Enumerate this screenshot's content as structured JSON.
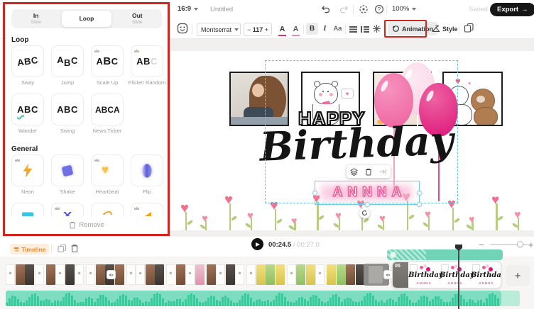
{
  "topbar": {
    "aspect_ratio": "16:9",
    "project_title": "Untitled",
    "zoom_level": "100%",
    "saved_label": "Saved",
    "export_label": "Export",
    "export_arrow": "→"
  },
  "text_toolbar": {
    "font_name": "Montserrat",
    "size_minus": "−",
    "font_size": "117",
    "size_plus": "+",
    "color_letter": "A",
    "highlight_letter": "A",
    "bold": "B",
    "italic": "I",
    "case": "Aa",
    "animation": "Animation",
    "style": "Style"
  },
  "animation_panel": {
    "tabs": [
      {
        "label": "In",
        "sublabel": "Slide",
        "active": false
      },
      {
        "label": "Loop",
        "sublabel": "",
        "active": true
      },
      {
        "label": "Out",
        "sublabel": "Slide",
        "active": false
      }
    ],
    "loop_section": {
      "title": "Loop",
      "items": [
        {
          "label": "Sway",
          "demo": "ABC",
          "variant": "sway",
          "premium": false
        },
        {
          "label": "Jump",
          "demo": "ABC",
          "variant": "jump",
          "premium": false
        },
        {
          "label": "Scale Up",
          "demo": "ABC",
          "variant": "scaleup",
          "premium": true
        },
        {
          "label": "Flicker Random",
          "demo": "ABC",
          "variant": "flicker",
          "premium": true
        },
        {
          "label": "Wander",
          "demo": "ABC",
          "variant": "wander",
          "premium": false
        },
        {
          "label": "Swing",
          "demo": "ABC",
          "variant": "swing",
          "premium": false
        },
        {
          "label": "News Ticker",
          "demo": "ABC A",
          "variant": "ticker",
          "premium": false
        }
      ]
    },
    "general_section": {
      "title": "General",
      "items": [
        {
          "label": "Neon",
          "icon": "lightning-bolt",
          "premium": true
        },
        {
          "label": "Shake",
          "icon": "shaking-square",
          "premium": false
        },
        {
          "label": "Heartbeat",
          "icon": "heart",
          "premium": true
        },
        {
          "label": "Flip",
          "icon": "flipping-ellipse",
          "premium": false
        }
      ],
      "partial_items": [
        {
          "icon": "teal-bar",
          "premium": false
        },
        {
          "icon": "blue-arrows",
          "premium": true
        },
        {
          "icon": "orange-swirl",
          "premium": false
        },
        {
          "icon": "orange-wedge",
          "premium": true
        }
      ]
    },
    "remove_label": "Remove"
  },
  "canvas": {
    "happy_text": "HAPPY",
    "birthday_text": "Birthday",
    "name_text": "ANNNA"
  },
  "playback": {
    "current_time": "00:24.5",
    "separator": "/",
    "total_time": "00:27.0",
    "zoom_out": "−",
    "zoom_in": "+"
  },
  "timeline": {
    "label": "Timeline",
    "selected_clip_badge": "05",
    "clip_text": "Birthday",
    "clip_subtext": "ANNNA",
    "add_label": "+"
  },
  "colors": {
    "annotation_red": "#d3251d",
    "accent_teal": "#72d4b7",
    "waveform_green": "#3fc79b",
    "balloon_pink": "#ee5f9e",
    "balloon_light_pink": "#f7cfe2",
    "balloon_magenta": "#dc1378",
    "name_pink": "#ee5f9b",
    "timeline_orange": "#ee8a35"
  }
}
